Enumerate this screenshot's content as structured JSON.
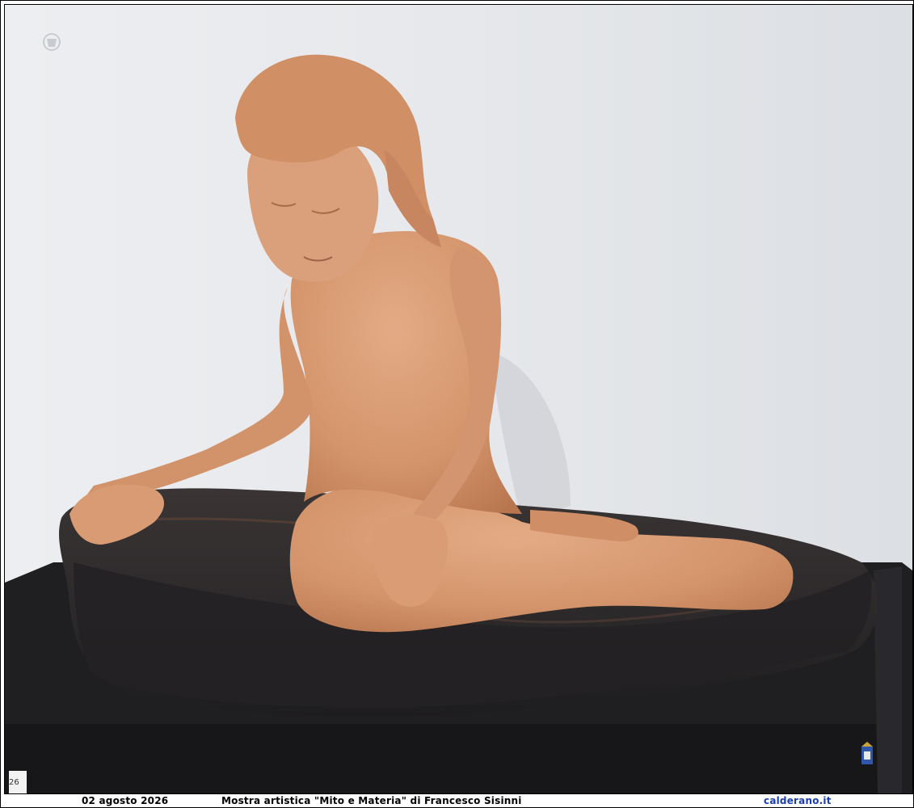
{
  "caption": {
    "date": "02 agosto 2026",
    "title": "Mostra artistica \"Mito e Materia\" di Francesco Sisinni",
    "site": "calderano.it"
  },
  "photo": {
    "corner_label": "26",
    "colors": {
      "wall": "#e7e9ec",
      "terracotta": "#d79a72",
      "base_dark": "#2a2829",
      "pedestal": "#1f1f22",
      "site_link": "#1a3fb0"
    }
  }
}
